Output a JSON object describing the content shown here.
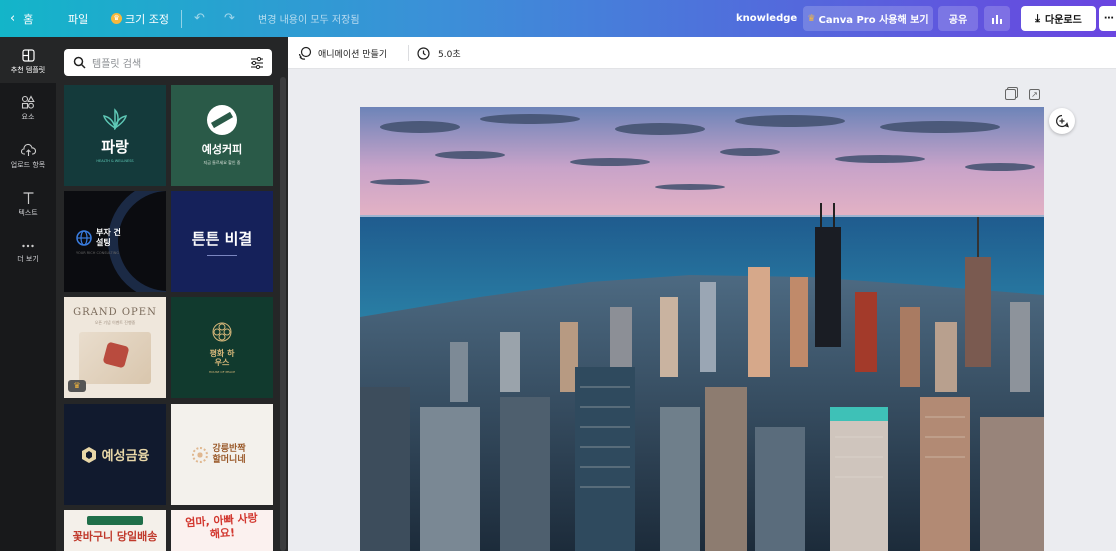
{
  "topbar": {
    "home_label": "홈",
    "file_label": "파일",
    "resize_label": "크기 조정",
    "save_status": "변경 내용이 모두 저장됨",
    "knowledge_label": "knowledge",
    "pro_label": "Canva Pro 사용해 보기",
    "share_label": "공유",
    "download_label": "다운로드"
  },
  "leftnav": {
    "items": [
      {
        "label": "추천 템플릿",
        "icon": "template-icon"
      },
      {
        "label": "요소",
        "icon": "elements-icon"
      },
      {
        "label": "업로드 항목",
        "icon": "upload-icon"
      },
      {
        "label": "텍스트",
        "icon": "text-icon"
      },
      {
        "label": "더 보기",
        "icon": "more-icon"
      }
    ]
  },
  "panel": {
    "search_placeholder": "템플릿 검색",
    "templates": [
      {
        "title": "파랑",
        "sub": "HEALTH & WELLNESS",
        "bg": "#143a3b",
        "fg": "#ffffff"
      },
      {
        "title": "예성커피",
        "sub": "지금 들르세요 할인 중",
        "bg": "#2a5a48",
        "fg": "#ffffff"
      },
      {
        "title": "부자 건설팅",
        "sub": "YOUR RICH CONSULTING",
        "bg": "#0b0c10",
        "fg": "#ffffff"
      },
      {
        "title": "튼튼 비결",
        "sub": "",
        "bg": "#15215a",
        "fg": "#ffffff"
      },
      {
        "title": "GRAND OPEN",
        "sub": "오픈 기념 이벤트 진행중",
        "bg": "#efe7dc",
        "fg": "#7a6a5a"
      },
      {
        "title": "평화 하우스",
        "sub": "HOUSE OF PEACE",
        "bg": "#113a2e",
        "fg": "#d6b77a"
      },
      {
        "title": "예성금융",
        "sub": "",
        "bg": "#111a2e",
        "fg": "#e8d7a8"
      },
      {
        "title": "강릉반짝 할머니네",
        "sub": "",
        "bg": "#f3f1ec",
        "fg": "#9a5a2a"
      },
      {
        "title": "꽃바구니 당일배송",
        "sub": "",
        "bg": "#f4f0ea",
        "fg": "#c0392b"
      },
      {
        "title": "엄마, 아빠 사랑해요!",
        "sub": "",
        "bg": "#fbf1ef",
        "fg": "#d2372f"
      }
    ]
  },
  "subbar": {
    "animate_label": "애니메이션 만들기",
    "duration_label": "5.0초"
  }
}
